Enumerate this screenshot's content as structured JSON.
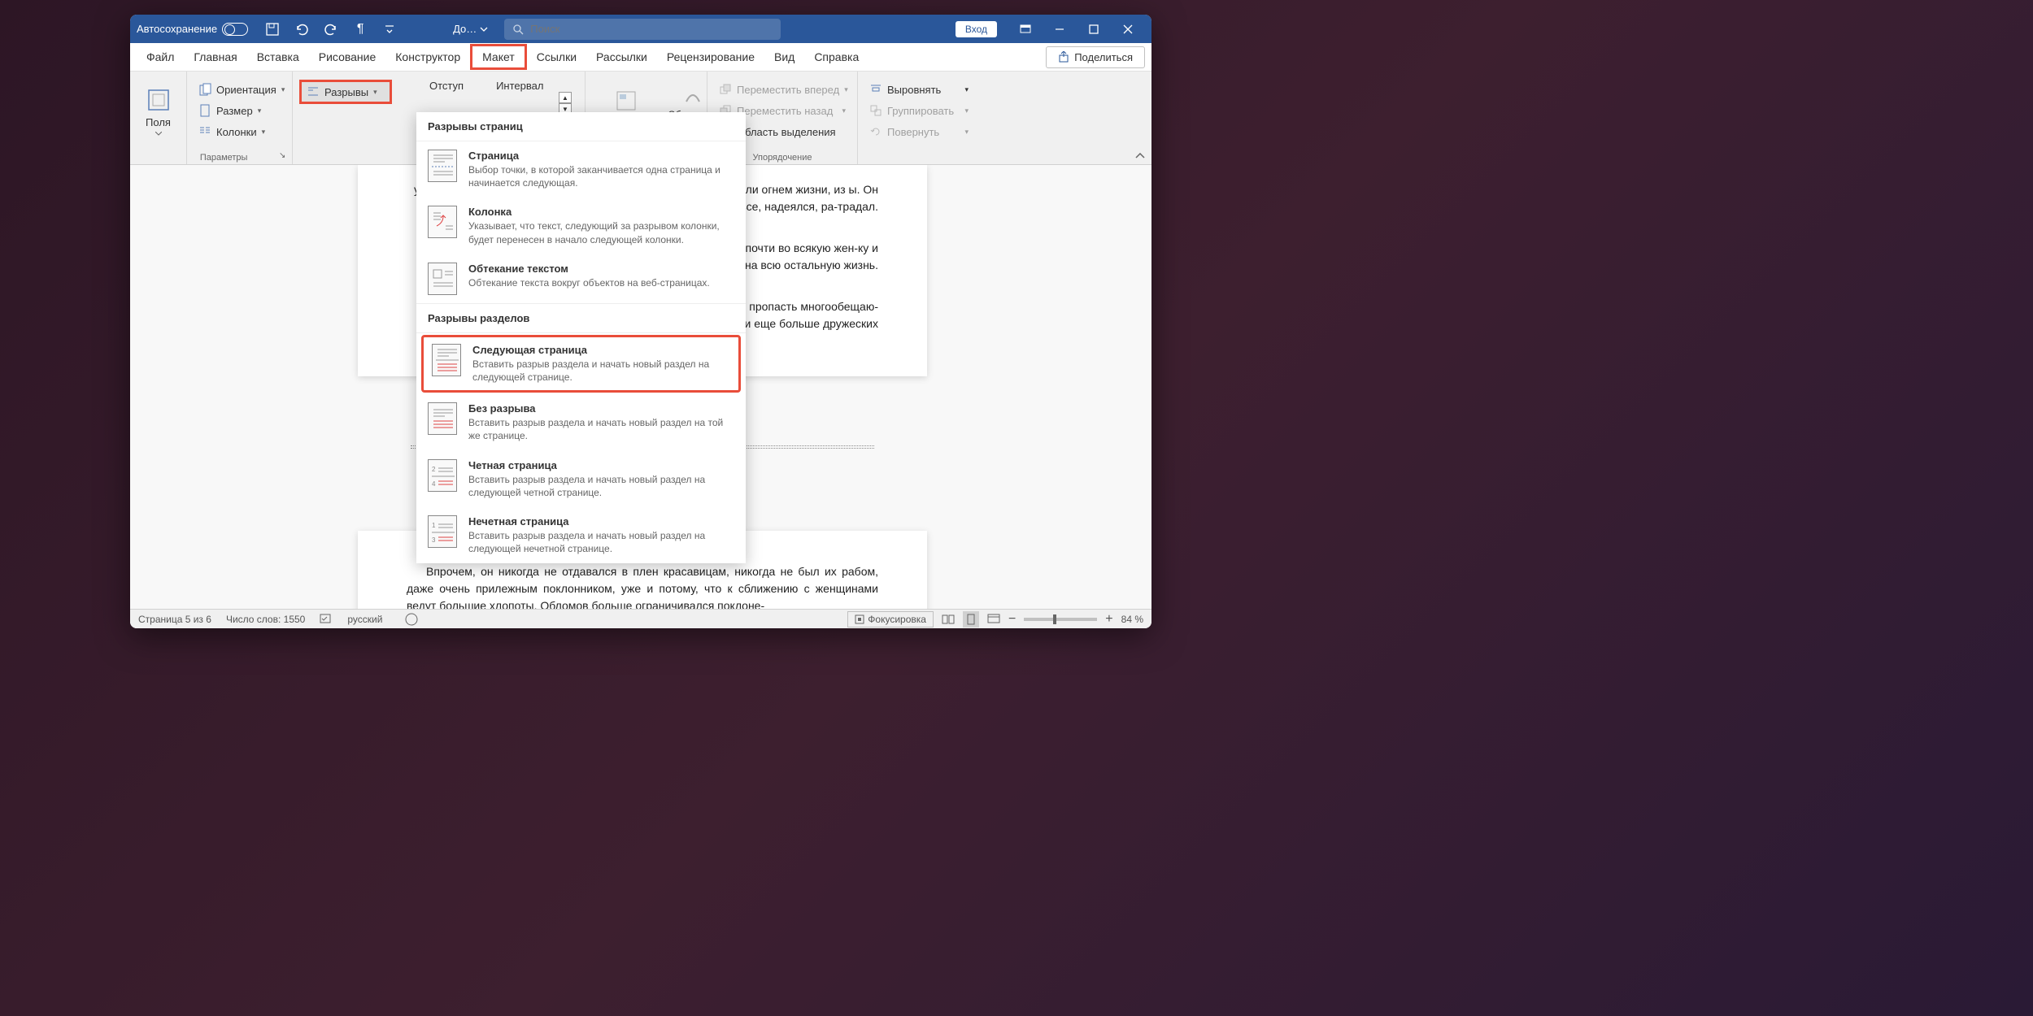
{
  "titleBar": {
    "autosave": "Автосохранение",
    "docTitle": "До…",
    "searchPlaceholder": "Поиск",
    "login": "Вход"
  },
  "tabs": {
    "file": "Файл",
    "home": "Главная",
    "insert": "Вставка",
    "draw": "Рисование",
    "design": "Конструктор",
    "layout": "Макет",
    "references": "Ссылки",
    "mailings": "Рассылки",
    "review": "Рецензирование",
    "view": "Вид",
    "help": "Справка",
    "share": "Поделиться"
  },
  "ribbon": {
    "margins": "Поля",
    "orientation": "Ориентация",
    "size": "Размер",
    "columns": "Колонки",
    "breaks": "Разрывы",
    "groupPageSetup": "Параметры",
    "indent": "Отступ",
    "spacing": "Интервал",
    "position": "Положение",
    "wrap": "Обтекание текстом",
    "bringForward": "Переместить вперед",
    "sendBackward": "Переместить назад",
    "selectionPane": "Область выделения",
    "align": "Выровнять",
    "group": "Группировать",
    "rotate": "Повернуть",
    "groupArrange": "Упорядочение"
  },
  "dropdown": {
    "header1": "Разрывы страниц",
    "page": {
      "title": "Страница",
      "desc": "Выбор точки, в которой заканчивается одна страница и начинается следующая."
    },
    "column": {
      "title": "Колонка",
      "desc": "Указывает, что текст, следующий за разрывом колонки, будет перенесен в начало следующей колонки."
    },
    "textWrap": {
      "title": "Обтекание текстом",
      "desc": "Обтекание текста вокруг объектов на веб-страницах."
    },
    "header2": "Разрывы разделов",
    "nextPage": {
      "title": "Следующая страница",
      "desc": "Вставить разрыв раздела и начать новый раздел на следующей странице."
    },
    "continuous": {
      "title": "Без разрыва",
      "desc": "Вставить разрыв раздела и начать новый раздел на той же странице."
    },
    "evenPage": {
      "title": "Четная страница",
      "desc": "Вставить разрыв раздела и начать новый раздел на следующей четной странице."
    },
    "oddPage": {
      "title": "Нечетная страница",
      "desc": "Вставить разрыв раздела и начать новый раздел на следующей нечетной странице."
    }
  },
  "document": {
    "p1": "урге, в его ранние, молодые годы, покой-де, глаза подолгу сияли огнем жизни, из ы. Он волновался, как и все, надеялся, ра-традал.",
    "p2": "ную пору, когда человек во всяком другом руга и влюбляется почти во всякую жен-ку и сердце, что иным даже и удастся со-рию потом на всю остальную жизнь.",
    "p3": "Ильича тоже выпало немало мягких, бар-голпы красавиц, пропасть многообещаю-рванные поцелуя и еще больше дружеских",
    "p4": "Впрочем, он никогда не отдавался в плен красавицам, никогда не был их рабом, даже очень прилежным поклонником, уже и потому, что к сближению с женщинами ведут большие хлопоты. Обломов больше ограничивался поклоне-"
  },
  "statusBar": {
    "page": "Страница 5 из 6",
    "words": "Число слов: 1550",
    "lang": "русский",
    "focus": "Фокусировка",
    "zoom": "84 %"
  }
}
